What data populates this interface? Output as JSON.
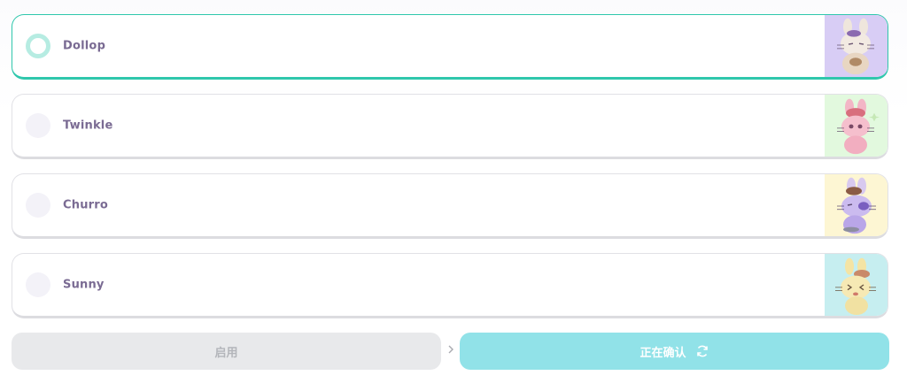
{
  "options": [
    {
      "name": "Dollop",
      "selected": true,
      "thumb_bg": "#d8cdf5"
    },
    {
      "name": "Twinkle",
      "selected": false,
      "thumb_bg": "#e2f9de"
    },
    {
      "name": "Churro",
      "selected": false,
      "thumb_bg": "#fdf6d3"
    },
    {
      "name": "Sunny",
      "selected": false,
      "thumb_bg": "#c6eef0"
    }
  ],
  "actions": {
    "enable_label": "启用",
    "confirm_label": "正在确认",
    "separator_icon": "chevron-right-icon",
    "confirm_icon": "refresh-icon"
  },
  "colors": {
    "accent": "#2fc7ac",
    "confirm_bg": "#91e2e8",
    "disabled_bg": "#e8e9eb",
    "label_color": "#7a6b93"
  }
}
